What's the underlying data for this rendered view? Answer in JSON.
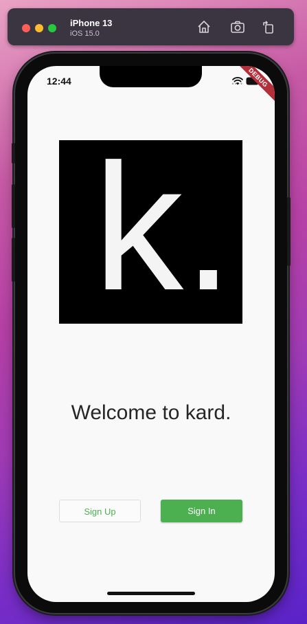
{
  "simulator": {
    "device_name": "iPhone 13",
    "os_version": "iOS 15.0",
    "icons": [
      "home-icon",
      "screenshot-icon",
      "rotate-icon"
    ]
  },
  "status_bar": {
    "time": "12:44",
    "debug_banner": "DEBUG",
    "icons": [
      "wifi-icon",
      "battery-icon"
    ]
  },
  "app": {
    "logo_text": "k.",
    "welcome_text": "Welcome to kard.",
    "buttons": {
      "sign_up": "Sign Up",
      "sign_in": "Sign In"
    }
  },
  "colors": {
    "accent_green": "#4caf50",
    "debug_red": "#b3303b",
    "logo_bg": "#000000"
  }
}
